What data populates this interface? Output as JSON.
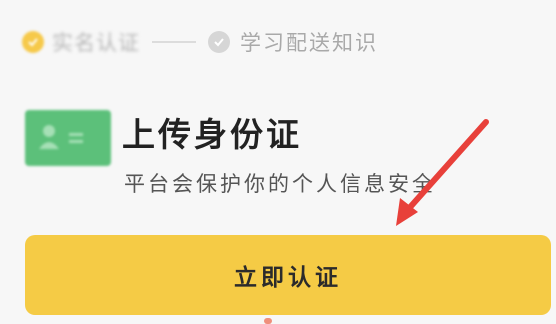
{
  "steps": {
    "step1_label": "实名认证",
    "step2_label": "学习配送知识"
  },
  "upload": {
    "title": "上传身份证",
    "subtitle": "平台会保护你的个人信息安全"
  },
  "actions": {
    "verify_label": "立即认证"
  },
  "colors": {
    "accent": "#f5cb45",
    "arrow": "#e8403a",
    "id_card": "#5cc07a"
  },
  "icons": {
    "step1": "check-circle-icon",
    "step2": "check-circle-icon",
    "id_card": "id-card-icon",
    "annotation": "red-arrow"
  }
}
